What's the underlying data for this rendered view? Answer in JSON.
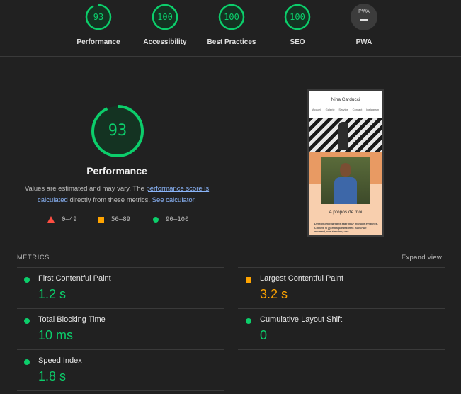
{
  "top_scores": [
    {
      "label": "Performance",
      "score": "93"
    },
    {
      "label": "Accessibility",
      "score": "100"
    },
    {
      "label": "Best Practices",
      "score": "100"
    },
    {
      "label": "SEO",
      "score": "100"
    },
    {
      "label": "PWA",
      "score": "PWA"
    }
  ],
  "performance": {
    "score": "93",
    "title": "Performance",
    "desc_prefix": "Values are estimated and may vary. The ",
    "link_score": "performance score is calculated",
    "desc_middle": " directly from these metrics. ",
    "link_calc": "See calculator."
  },
  "legend": {
    "red": "0–49",
    "orange": "50–89",
    "green": "90–100"
  },
  "thumbnail": {
    "site_title": "Nina Carducci",
    "nav": [
      "Accueil",
      "Galerie",
      "Service",
      "Contact",
      "Instagram"
    ],
    "about": "A propos de moi",
    "text": "Derenir photographe était pour moi une évidence. Comme si j'y étais prédestinée. Saisir un moment, une émotion, une"
  },
  "metrics": {
    "heading": "METRICS",
    "expand_label": "Expand view",
    "items": [
      {
        "name": "First Contentful Paint",
        "value": "1.2 s",
        "status": "green"
      },
      {
        "name": "Largest Contentful Paint",
        "value": "3.2 s",
        "status": "orange"
      },
      {
        "name": "Total Blocking Time",
        "value": "10 ms",
        "status": "green"
      },
      {
        "name": "Cumulative Layout Shift",
        "value": "0",
        "status": "green"
      },
      {
        "name": "Speed Index",
        "value": "1.8 s",
        "status": "green"
      }
    ]
  },
  "colors": {
    "green": "#0cce6b",
    "orange": "#ffa400",
    "red": "#ff4e42",
    "background": "#212121"
  }
}
